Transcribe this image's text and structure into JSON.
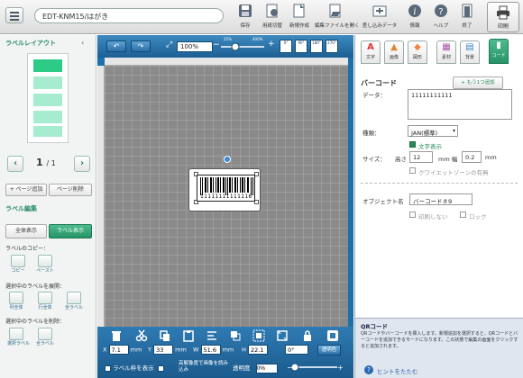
{
  "document": {
    "name": "EDT-KNM15/はがき"
  },
  "toolbar": {
    "items": [
      {
        "label": "保存",
        "icon": "save-icon"
      },
      {
        "label": "用紙切替",
        "icon": "paper-switch-icon"
      },
      {
        "label": "新規作成",
        "icon": "new-file-icon"
      },
      {
        "label": "編集ファイルを開く",
        "icon": "open-file-icon"
      },
      {
        "label": "差し込みデータ",
        "icon": "merge-data-icon"
      },
      {
        "label": "情報",
        "icon": "info-icon"
      },
      {
        "label": "ヘルプ",
        "icon": "help-icon"
      },
      {
        "label": "終了",
        "icon": "exit-icon"
      }
    ],
    "print_label": "印刷"
  },
  "left": {
    "layout_title": "ラベルレイアウト",
    "page_current": "1",
    "page_total": "/ 1",
    "add_page": "+ ページ追加",
    "delete_page": "ページ削除",
    "edit_title": "ラベル編集",
    "show_all": "全体表示",
    "show_label": "ラベル表示",
    "copy_title": "ラベルのコピー：",
    "copy": "コピー",
    "paste": "ペースト",
    "expand_title": "選択中のラベルを展開：",
    "expand_col": "列全体",
    "expand_row": "行全体",
    "expand_all": "全ラベル",
    "delete_title": "選択中のラベルを削除：",
    "delete_selected": "選択ラベル",
    "delete_all": "全ラベル"
  },
  "canvas": {
    "zoom": "100%",
    "zoom_min": "25%",
    "zoom_max": "400%",
    "barcode_text": "11111111111116",
    "x_label": "X",
    "x_value": "7.1",
    "y_label": "Y",
    "y_value": "33",
    "w_label": "W",
    "w_value": "51.6",
    "h_label": "H",
    "h_value": "22.1",
    "unit": "mm",
    "rotation": "0°",
    "transparent_color": "透明色",
    "show_frame": "ラベル枠を表示",
    "hi_res": "高解像度で画像を読み込み",
    "transparency_label": "透明度",
    "transparency_value": "0%"
  },
  "right": {
    "tabs": [
      {
        "label": "文字",
        "glyph": "A"
      },
      {
        "label": "画像",
        "glyph": "▲"
      },
      {
        "label": "図形",
        "glyph": "◆"
      },
      {
        "label": "素材",
        "glyph": "▦"
      },
      {
        "label": "背景",
        "glyph": "▤"
      },
      {
        "label": "コード",
        "glyph": "▮"
      }
    ],
    "title": "バーコード",
    "add_more": "+ もう1つ追加",
    "data_label": "データ：",
    "data_value": "11111111111",
    "type_label": "種類：",
    "type_value": "JAN(標準)",
    "show_text": "文字表示",
    "size_label": "サイズ：",
    "height_label": "高さ",
    "height_value": "12",
    "width_label": "mm 幅",
    "width_value": "0.2",
    "mm": "mm",
    "quiet_zone": "クワイエットゾーンの有無",
    "object_name_label": "オブジェクト名",
    "object_name_value": "バーコード＃9",
    "no_print": "印刷しない",
    "lock": "ロック",
    "help_title": "QRコード",
    "help_text": "QRコードやバーコードを挿入します。新規追加を選択すると、QRコードとバーコードを追加できるモードになります。この状態で編集の画面をクリックすると追加されます。",
    "help_close": "ヒントをたたむ"
  },
  "colors": {
    "accent": "#2a9a72",
    "canvas_blue": "#1f6fa8"
  }
}
